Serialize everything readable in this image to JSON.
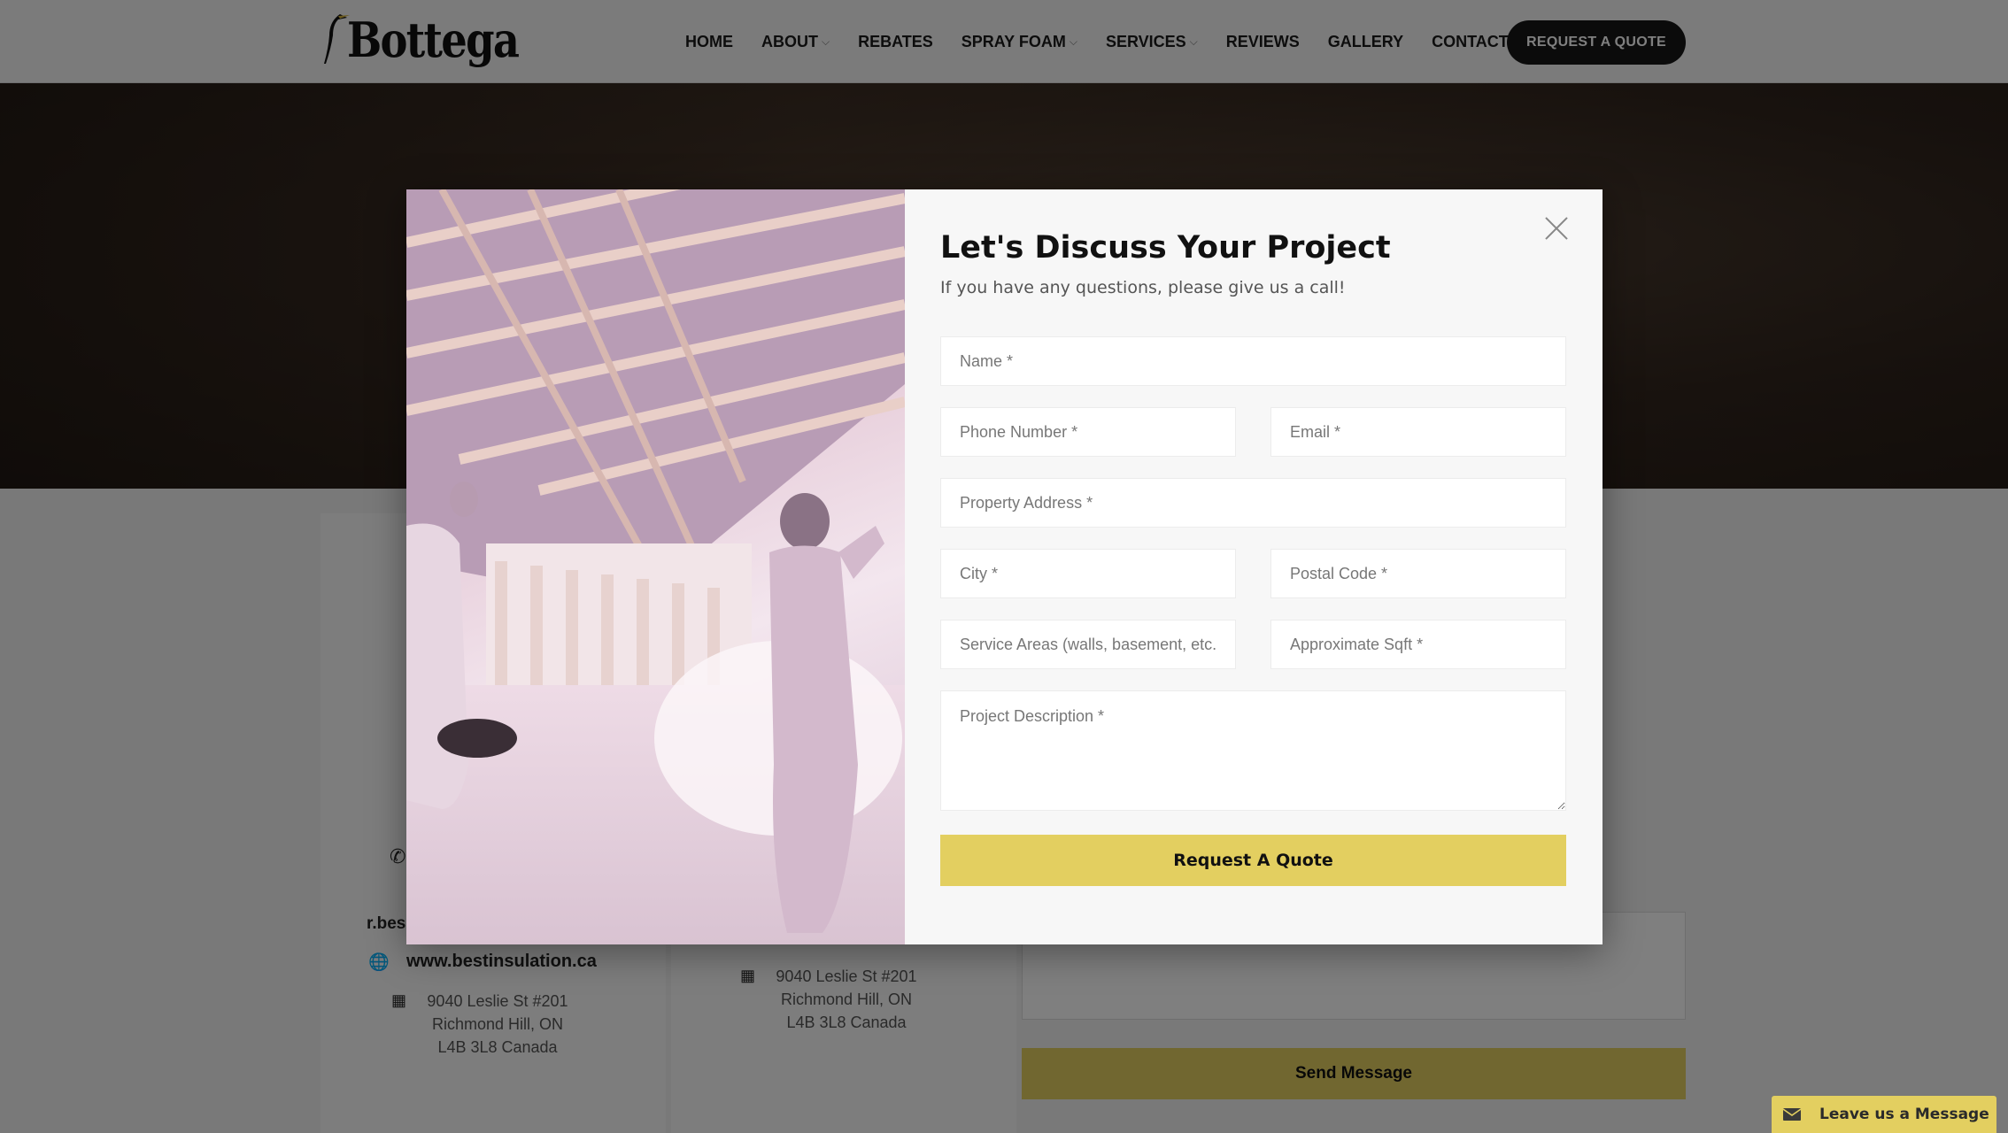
{
  "header": {
    "logo_text": "Bottega",
    "nav": [
      {
        "label": "HOME",
        "dropdown": false
      },
      {
        "label": "ABOUT",
        "dropdown": true
      },
      {
        "label": "REBATES",
        "dropdown": false
      },
      {
        "label": "SPRAY FOAM",
        "dropdown": true
      },
      {
        "label": "SERVICES",
        "dropdown": true
      },
      {
        "label": "REVIEWS",
        "dropdown": false
      },
      {
        "label": "GALLERY",
        "dropdown": false
      },
      {
        "label": "CONTACT",
        "dropdown": false
      }
    ],
    "quote_button": "REQUEST A QUOTE"
  },
  "background": {
    "email_partial": "r.bes",
    "website": "www.bestinsulation.ca",
    "address_1": {
      "line1": "9040 Leslie St #201",
      "line2": "Richmond Hill, ON",
      "line3": "L4B 3L8 Canada"
    },
    "address_2": {
      "line1": "9040 Leslie St #201",
      "line2": "Richmond Hill, ON",
      "line3": "L4B 3L8 Canada"
    },
    "send_button": "Send Message"
  },
  "modal": {
    "title": "Let's Discuss Your Project",
    "subtitle": "If you have any questions, please give us a call!",
    "fields": {
      "name": "Name *",
      "phone": "Phone Number *",
      "email": "Email *",
      "address": "Property Address *",
      "city": "City *",
      "postal": "Postal Code *",
      "service_areas": "Service Areas (walls, basement, etc.",
      "sqft": "Approximate Sqft *",
      "description": "Project Description *"
    },
    "submit": "Request A Quote"
  },
  "chat_widget": {
    "label": "Leave us a Message"
  },
  "colors": {
    "accent": "#e3cf60",
    "dark": "#161616"
  }
}
